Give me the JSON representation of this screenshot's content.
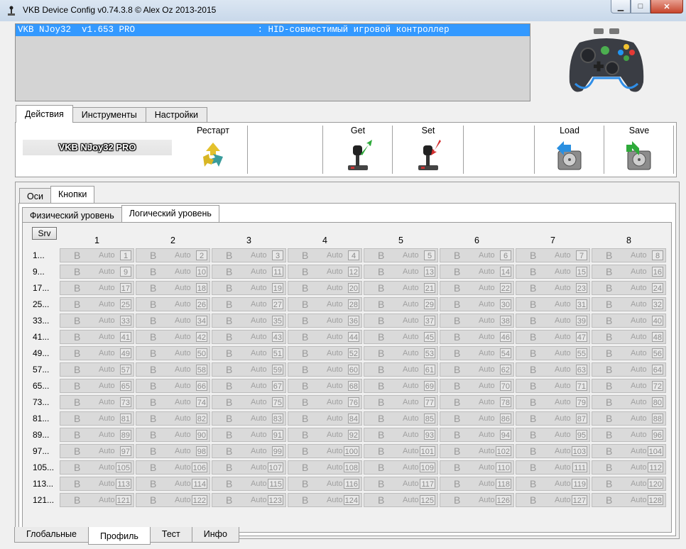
{
  "window": {
    "title": "VKB Device Config v0.74.3.8 © Alex Oz 2013-2015"
  },
  "device_list": [
    {
      "text": "VKB NJoy32  v1.653 PRO                       : HID-совместимый игровой контроллер"
    }
  ],
  "top_tabs": [
    "Действия",
    "Инструменты",
    "Настройки"
  ],
  "toolbar": {
    "device_name": "VKB NJoy32 PRO",
    "restart": "Рестарт",
    "get": "Get",
    "set": "Set",
    "load": "Load",
    "save": "Save"
  },
  "section_tabs": [
    "Оси",
    "Кнопки"
  ],
  "level_tabs": [
    "Физический уровень",
    "Логический уровень"
  ],
  "grid": {
    "srv": "Srv",
    "columns": [
      "1",
      "2",
      "3",
      "4",
      "5",
      "6",
      "7",
      "8"
    ],
    "rows": [
      "1...",
      "9...",
      "17...",
      "25...",
      "33...",
      "41...",
      "49...",
      "57...",
      "65...",
      "73...",
      "81...",
      "89...",
      "97...",
      "105...",
      "113...",
      "121..."
    ],
    "cell_b": "B",
    "cell_mode": "Auto",
    "numbers": [
      [
        "1",
        "2",
        "3",
        "4",
        "5",
        "6",
        "7",
        "8"
      ],
      [
        "9",
        "10",
        "11",
        "12",
        "13",
        "14",
        "15",
        "16"
      ],
      [
        "17",
        "18",
        "19",
        "20",
        "21",
        "22",
        "23",
        "24"
      ],
      [
        "25",
        "26",
        "27",
        "28",
        "29",
        "30",
        "31",
        "32"
      ],
      [
        "33",
        "34",
        "35",
        "36",
        "37",
        "38",
        "39",
        "40"
      ],
      [
        "41",
        "42",
        "43",
        "44",
        "45",
        "46",
        "47",
        "48"
      ],
      [
        "49",
        "50",
        "51",
        "52",
        "53",
        "54",
        "55",
        "56"
      ],
      [
        "57",
        "58",
        "59",
        "60",
        "61",
        "62",
        "63",
        "64"
      ],
      [
        "65",
        "66",
        "67",
        "68",
        "69",
        "70",
        "71",
        "72"
      ],
      [
        "73",
        "74",
        "75",
        "76",
        "77",
        "78",
        "79",
        "80"
      ],
      [
        "81",
        "82",
        "83",
        "84",
        "85",
        "86",
        "87",
        "88"
      ],
      [
        "89",
        "90",
        "91",
        "92",
        "93",
        "94",
        "95",
        "96"
      ],
      [
        "97",
        "98",
        "99",
        "100",
        "101",
        "102",
        "103",
        "104"
      ],
      [
        "105",
        "106",
        "107",
        "108",
        "109",
        "110",
        "111",
        "112"
      ],
      [
        "113",
        "114",
        "115",
        "116",
        "117",
        "118",
        "119",
        "120"
      ],
      [
        "121",
        "122",
        "123",
        "124",
        "125",
        "126",
        "127",
        "128"
      ]
    ]
  },
  "bottom_tabs": [
    "Глобальные",
    "Профиль",
    "Тест",
    "Инфо"
  ]
}
